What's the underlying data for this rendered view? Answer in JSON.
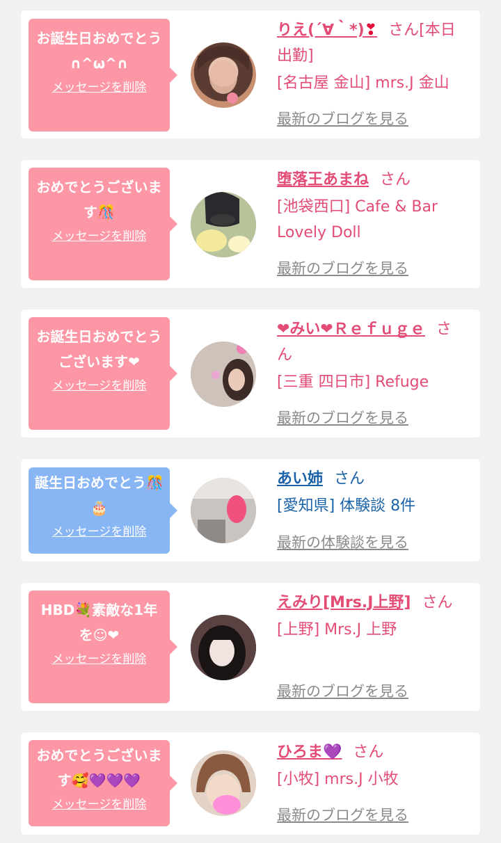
{
  "items": [
    {
      "message": "お誕生日おめでとう∩^ω^∩",
      "delete_label": "メッセージを削除",
      "name": "りえ(´∀｀*)",
      "name_emoji": "❣",
      "san": "さん",
      "extra": "[本日出勤]",
      "location": "[名古屋 金山] mrs.J 金山",
      "link": "最新のブログを見る",
      "theme": "pink"
    },
    {
      "message": "おめでとうございます🎊",
      "delete_label": "メッセージを削除",
      "name": "堕落王あまね",
      "name_emoji": "",
      "san": "さん",
      "extra": "",
      "location": "[池袋西口] Cafe & Bar Lovely Doll",
      "link": "最新のブログを見る",
      "theme": "pink"
    },
    {
      "message": "お誕生日おめでとうございます❤",
      "delete_label": "メッセージを削除",
      "name": "❤みい❤Ｒｅｆｕｇｅ",
      "name_emoji": "",
      "san": "さん",
      "extra": "",
      "location": "[三重 四日市] Refuge",
      "link": "最新のブログを見る",
      "theme": "pink"
    },
    {
      "message": "誕生日おめでとう🎊🎂",
      "delete_label": "メッセージを削除",
      "name": "あい姉",
      "name_emoji": "",
      "san": "さん",
      "extra": "",
      "location": "[愛知県] 体験談 8件",
      "link": "最新の体験談を見る",
      "theme": "blue"
    },
    {
      "message": "HBD💐素敵な1年を☺❤",
      "delete_label": "メッセージを削除",
      "name": "えみり[Mrs.J上野]",
      "name_emoji": "",
      "san": "さん",
      "extra": "",
      "location": "[上野] Mrs.J 上野",
      "link": "最新のブログを見る",
      "theme": "pink"
    },
    {
      "message": "おめでとうございます🥰💜💜💜",
      "delete_label": "メッセージを削除",
      "name": "ひろま",
      "name_emoji": "💜",
      "san": "さん",
      "extra": "",
      "location": "[小牧] mrs.J 小牧",
      "link": "最新のブログを見る",
      "theme": "pink"
    }
  ],
  "colors": {
    "pink_bubble": "#fd97a6",
    "blue_bubble": "#88b6f5",
    "pink_text": "#e24c75",
    "blue_text": "#1b63a8",
    "link_gray": "#8a8a8a"
  }
}
